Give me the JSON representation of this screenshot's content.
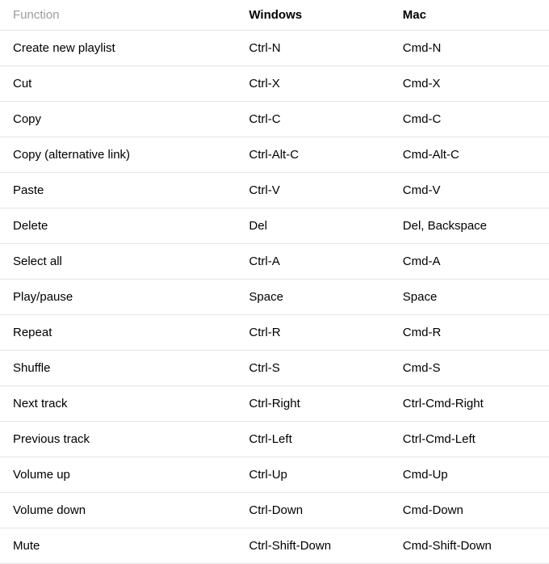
{
  "table": {
    "headers": {
      "function": "Function",
      "windows": "Windows",
      "mac": "Mac"
    },
    "rows": [
      {
        "function": "Create new playlist",
        "windows": "Ctrl-N",
        "mac": "Cmd-N"
      },
      {
        "function": "Cut",
        "windows": "Ctrl-X",
        "mac": "Cmd-X"
      },
      {
        "function": "Copy",
        "windows": "Ctrl-C",
        "mac": "Cmd-C"
      },
      {
        "function": "Copy (alternative link)",
        "windows": "Ctrl-Alt-C",
        "mac": "Cmd-Alt-C"
      },
      {
        "function": "Paste",
        "windows": "Ctrl-V",
        "mac": "Cmd-V"
      },
      {
        "function": "Delete",
        "windows": "Del",
        "mac": "Del, Backspace"
      },
      {
        "function": "Select all",
        "windows": "Ctrl-A",
        "mac": "Cmd-A"
      },
      {
        "function": "Play/pause",
        "windows": "Space",
        "mac": "Space"
      },
      {
        "function": "Repeat",
        "windows": "Ctrl-R",
        "mac": "Cmd-R"
      },
      {
        "function": "Shuffle",
        "windows": "Ctrl-S",
        "mac": "Cmd-S"
      },
      {
        "function": "Next track",
        "windows": "Ctrl-Right",
        "mac": "Ctrl-Cmd-Right"
      },
      {
        "function": "Previous track",
        "windows": "Ctrl-Left",
        "mac": "Ctrl-Cmd-Left"
      },
      {
        "function": "Volume up",
        "windows": "Ctrl-Up",
        "mac": "Cmd-Up"
      },
      {
        "function": "Volume down",
        "windows": "Ctrl-Down",
        "mac": "Cmd-Down"
      },
      {
        "function": "Mute",
        "windows": "Ctrl-Shift-Down",
        "mac": "Cmd-Shift-Down"
      }
    ]
  }
}
